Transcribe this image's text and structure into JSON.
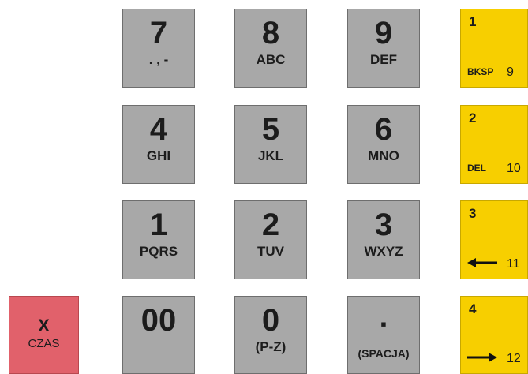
{
  "keys": {
    "k7": {
      "digit": "7",
      "sub": ". , -"
    },
    "k8": {
      "digit": "8",
      "sub": "ABC"
    },
    "k9": {
      "digit": "9",
      "sub": "DEF"
    },
    "k4": {
      "digit": "4",
      "sub": "GHI"
    },
    "k5": {
      "digit": "5",
      "sub": "JKL"
    },
    "k6": {
      "digit": "6",
      "sub": "MNO"
    },
    "k1": {
      "digit": "1",
      "sub": "PQRS"
    },
    "k2": {
      "digit": "2",
      "sub": "TUV"
    },
    "k3": {
      "digit": "3",
      "sub": "WXYZ"
    },
    "k00": {
      "digit": "00",
      "sub": ""
    },
    "k0": {
      "digit": "0",
      "sub": "(P-Z)"
    },
    "kdot": {
      "digit": "▪",
      "sub": "(SPACJA)"
    }
  },
  "fkeys": {
    "f1": {
      "num": "1",
      "label": "BKSP",
      "index": "9",
      "icon": "label"
    },
    "f2": {
      "num": "2",
      "label": "DEL",
      "index": "10",
      "icon": "label"
    },
    "f3": {
      "num": "3",
      "label": "",
      "index": "11",
      "icon": "arrow-left-icon"
    },
    "f4": {
      "num": "4",
      "label": "",
      "index": "12",
      "icon": "arrow-right-icon"
    }
  },
  "xkey": {
    "label": "X",
    "sub": "CZAS"
  },
  "colors": {
    "digit_key": "#a8a8a8",
    "function_key": "#f7cf00",
    "cancel_key": "#e1616b"
  }
}
